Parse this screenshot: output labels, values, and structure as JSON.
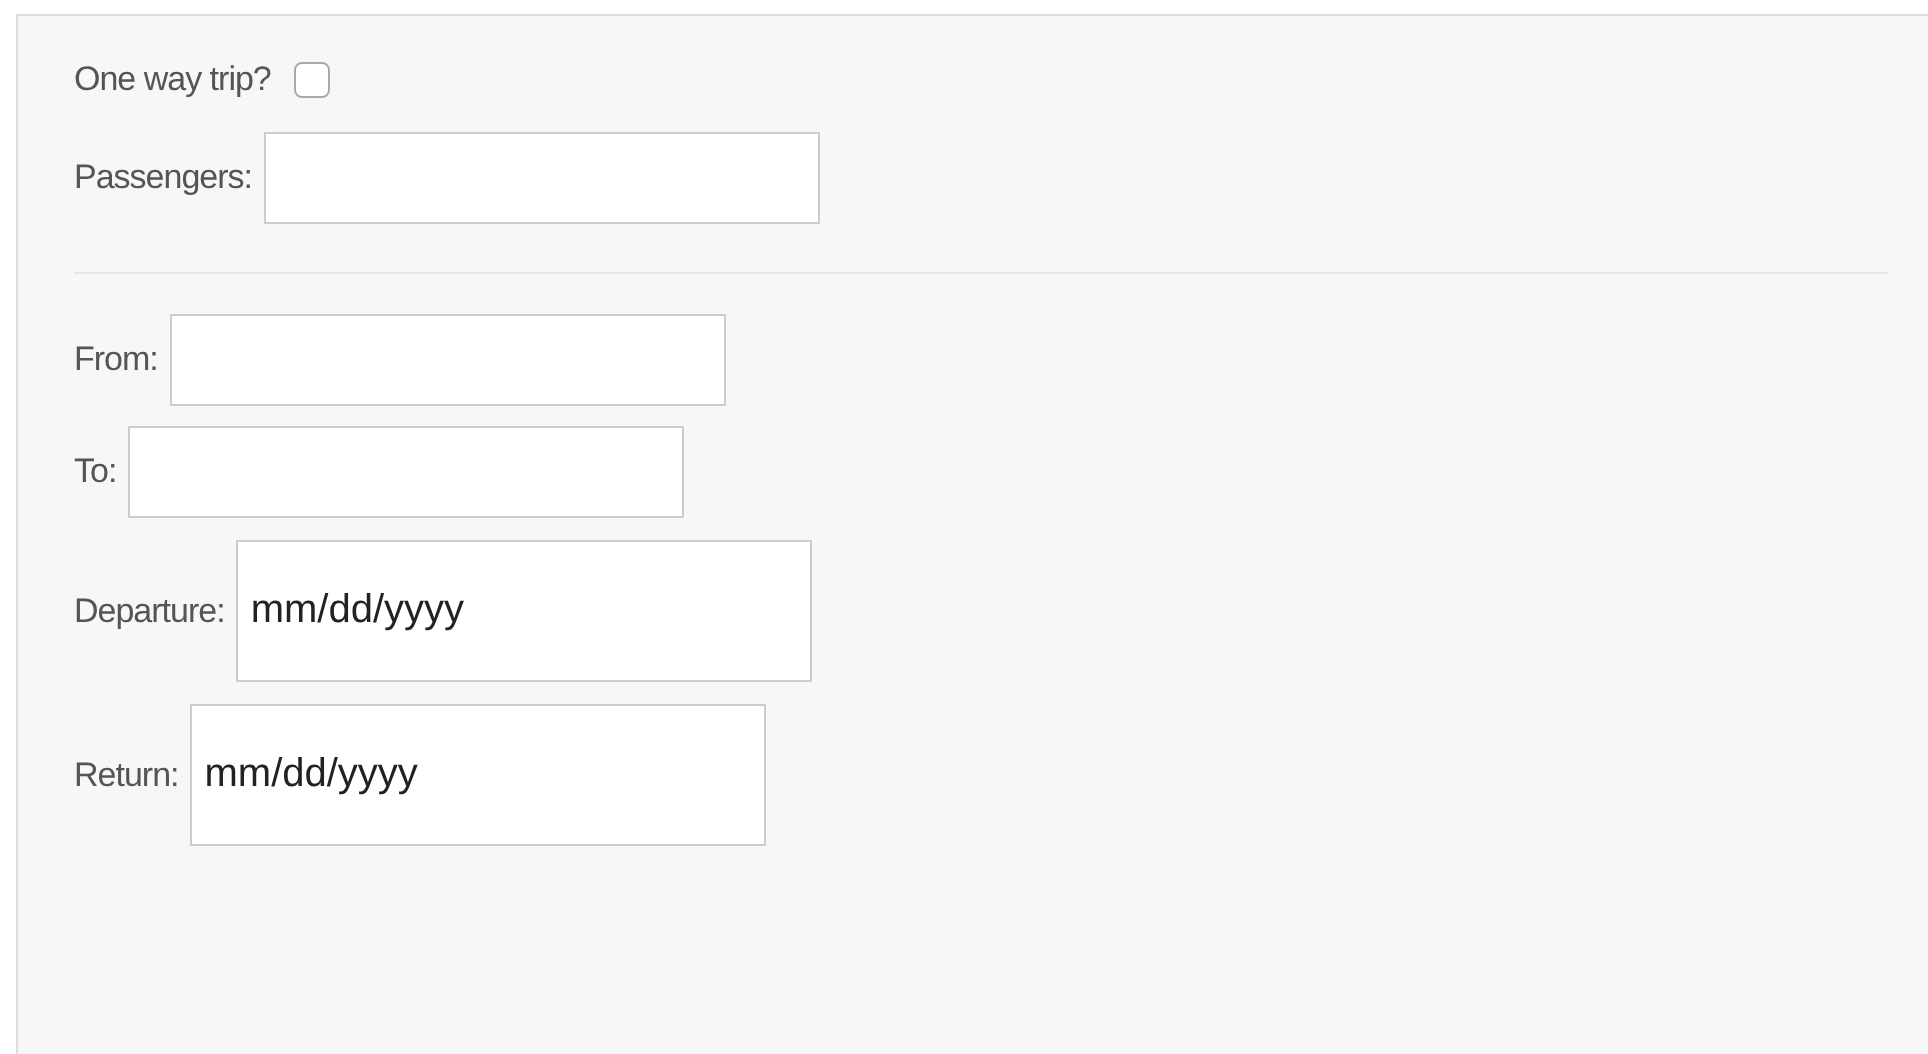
{
  "sections": [
    {
      "fields": [
        {
          "kind": "checkbox",
          "label": "One way trip?",
          "checked": false
        },
        {
          "kind": "text",
          "label": "Passengers:"
        }
      ]
    },
    {
      "fields": [
        {
          "kind": "text",
          "label": "From:"
        },
        {
          "kind": "text",
          "label": "To:"
        },
        {
          "kind": "date",
          "label": "Departure:",
          "placeholder": "mm/dd/yyyy"
        },
        {
          "kind": "date",
          "label": "Return:",
          "placeholder": "mm/dd/yyyy"
        }
      ]
    }
  ]
}
